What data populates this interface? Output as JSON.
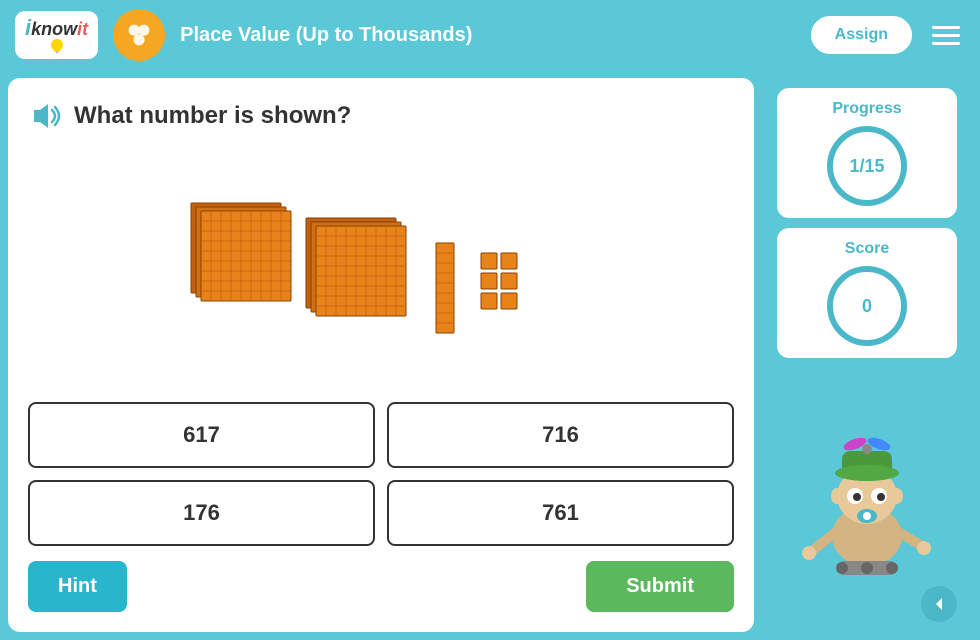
{
  "header": {
    "logo": {
      "text_i": "i",
      "text_know": "know",
      "text_it": "it"
    },
    "lesson_title": "Place Value (Up to Thousands)",
    "assign_label": "Assign",
    "hamburger_icon": "menu-icon"
  },
  "question": {
    "text": "What number is shown?",
    "sound_icon": "sound-icon"
  },
  "answers": [
    {
      "value": "617",
      "id": "a1"
    },
    {
      "value": "716",
      "id": "a2"
    },
    {
      "value": "176",
      "id": "a3"
    },
    {
      "value": "761",
      "id": "a4"
    }
  ],
  "buttons": {
    "hint_label": "Hint",
    "submit_label": "Submit"
  },
  "sidebar": {
    "progress_label": "Progress",
    "progress_value": "1/15",
    "score_label": "Score",
    "score_value": "0"
  },
  "colors": {
    "accent": "#4ab8c8",
    "orange": "#f5a623",
    "green": "#5cb85c",
    "hint_blue": "#29b6cc"
  }
}
